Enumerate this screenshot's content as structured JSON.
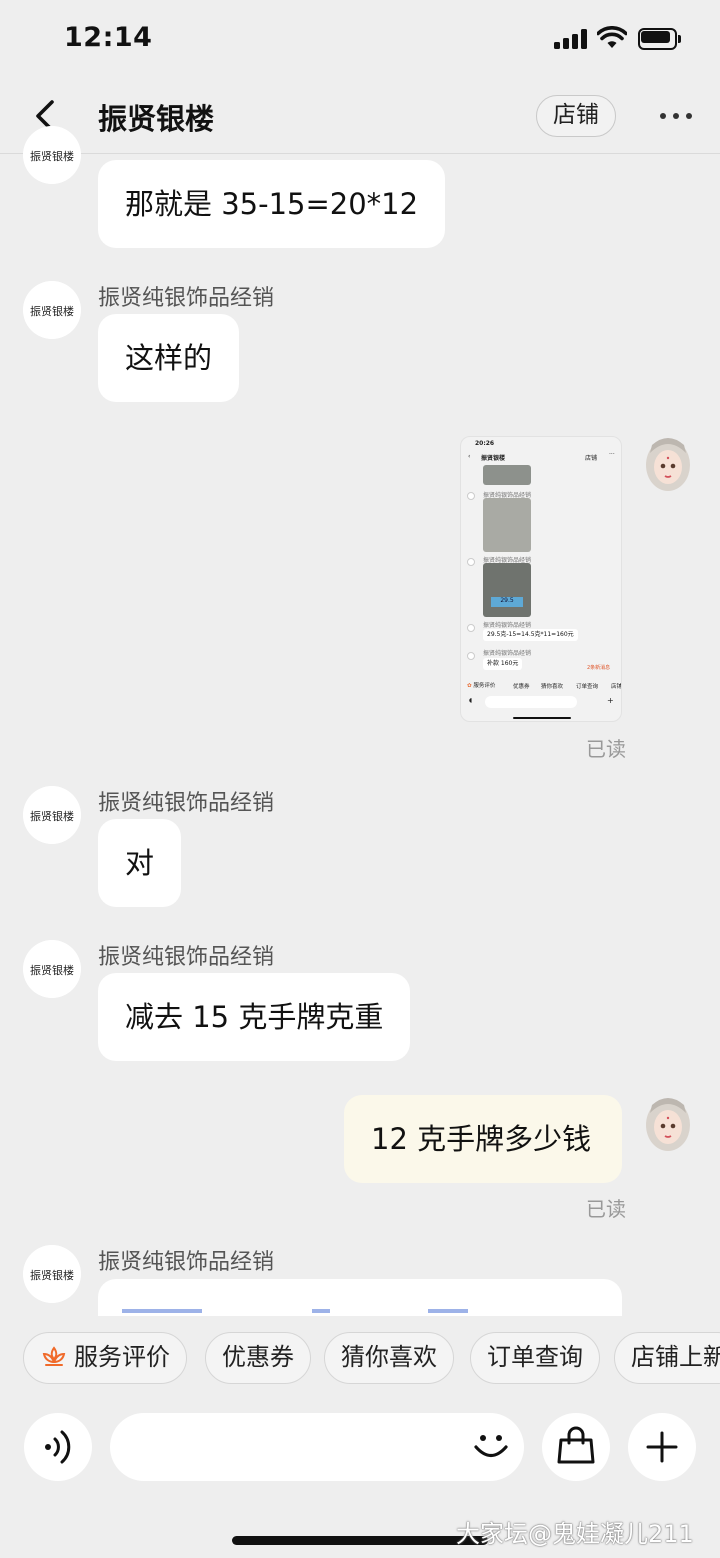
{
  "status_bar": {
    "time": "12:14"
  },
  "nav": {
    "title": "振贤银楼",
    "shop_label": "店铺"
  },
  "messages": {
    "m1": {
      "text": "那就是 35-15=20*12"
    },
    "m2": {
      "sender": "振贤纯银饰品经销",
      "text": "这样的"
    },
    "m3": {
      "status": "已读"
    },
    "m4": {
      "sender": "振贤纯银饰品经销",
      "text": "对"
    },
    "m5": {
      "sender": "振贤纯银饰品经销",
      "text": "减去 15 克手牌克重"
    },
    "m6": {
      "text": "12 克手牌多少钱",
      "status": "已读"
    },
    "m7": {
      "sender": "振贤纯银饰品经销"
    }
  },
  "shop_logo_text": "振贤银楼",
  "thumbnail": {
    "time": "20:26",
    "title": "振贤银楼",
    "shop": "店铺",
    "sender": "振贤纯银饰品经销",
    "scale_reading": "29.5",
    "msg_calc": "29.5克-15=14.5克*11=160元",
    "msg_pay": "补款 160元",
    "new_msgs": "2条新消息",
    "chips": [
      "服务评价",
      "优惠券",
      "猜你喜欢",
      "订单查询",
      "店铺"
    ]
  },
  "chips": [
    "服务评价",
    "优惠券",
    "猜你喜欢",
    "订单查询",
    "店铺上新"
  ],
  "input": {
    "placeholder": ""
  },
  "watermark": "大家坛@鬼娃凝儿211",
  "colors": {
    "background": "#eeeeee",
    "bubble": "#ffffff",
    "my_bubble": "#fbf8ea",
    "accent": "#f06a2a"
  },
  "icons": {
    "back": "chevron-left-icon",
    "more": "more-dots-icon",
    "voice": "voice-icon",
    "emoji": "emoji-icon",
    "bag": "shopping-bag-icon",
    "plus": "plus-icon",
    "service": "flower-icon"
  }
}
